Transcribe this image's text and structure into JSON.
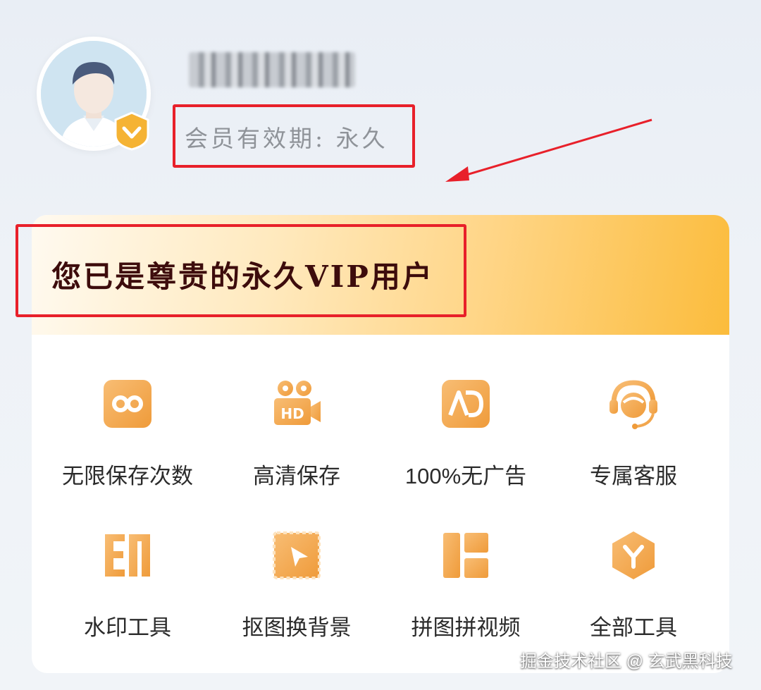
{
  "profile": {
    "membership_text": "会员有效期: 永久"
  },
  "banner": {
    "title": "您已是尊贵的永久VIP用户"
  },
  "features": [
    {
      "label": "无限保存次数",
      "icon": "infinity-icon"
    },
    {
      "label": "高清保存",
      "icon": "hd-camera-icon"
    },
    {
      "label": "100%无广告",
      "icon": "no-ad-icon"
    },
    {
      "label": "专属客服",
      "icon": "headset-icon"
    },
    {
      "label": "水印工具",
      "icon": "watermark-icon"
    },
    {
      "label": "抠图换背景",
      "icon": "cutout-icon"
    },
    {
      "label": "拼图拼视频",
      "icon": "collage-icon"
    },
    {
      "label": "全部工具",
      "icon": "all-tools-icon"
    }
  ],
  "watermark": "掘金技术社区 @ 玄武黑科技",
  "colors": {
    "accent": "#f6a63e",
    "banner_end": "#fbbc3c",
    "highlight": "#e8202a",
    "title_text": "#3d0c0c"
  }
}
